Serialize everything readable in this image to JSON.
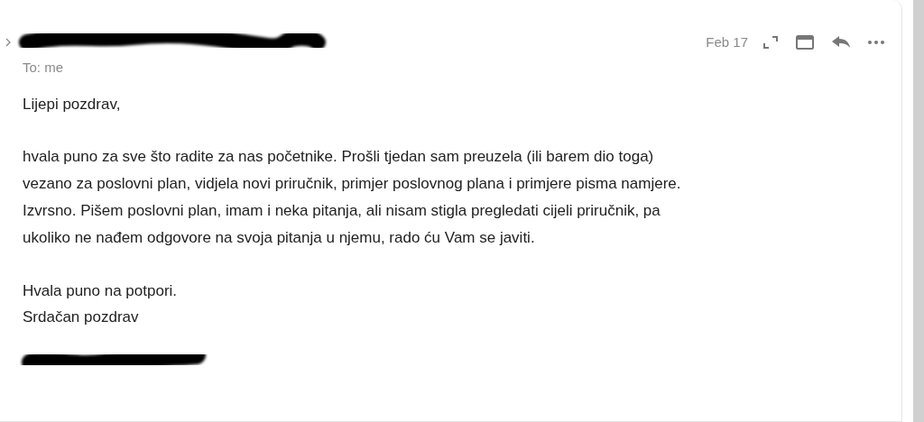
{
  "message": {
    "to": "To: me",
    "date": "Feb 17",
    "greeting": "Lijepi pozdrav,",
    "body": "hvala puno za sve što radite za nas početnike. Prošli tjedan sam preuzela (ili barem dio toga)\nvezano za poslovni plan, vidjela novi priručnik, primjer poslovnog plana i primjere pisma namjere.\nIzvrsno. Pišem poslovni plan, imam i neka pitanja, ali nisam stigla pregledati cijeli priručnik, pa\nukoliko ne nađem odgovore na svoja pitanja u njemu, rado ću Vam se javiti.",
    "closing": [
      "Hvala puno na potpori.",
      "Srdačan pozdrav"
    ]
  },
  "actions": [
    {
      "kind": "expand"
    },
    {
      "kind": "window"
    },
    {
      "kind": "reply"
    },
    {
      "kind": "more"
    }
  ]
}
